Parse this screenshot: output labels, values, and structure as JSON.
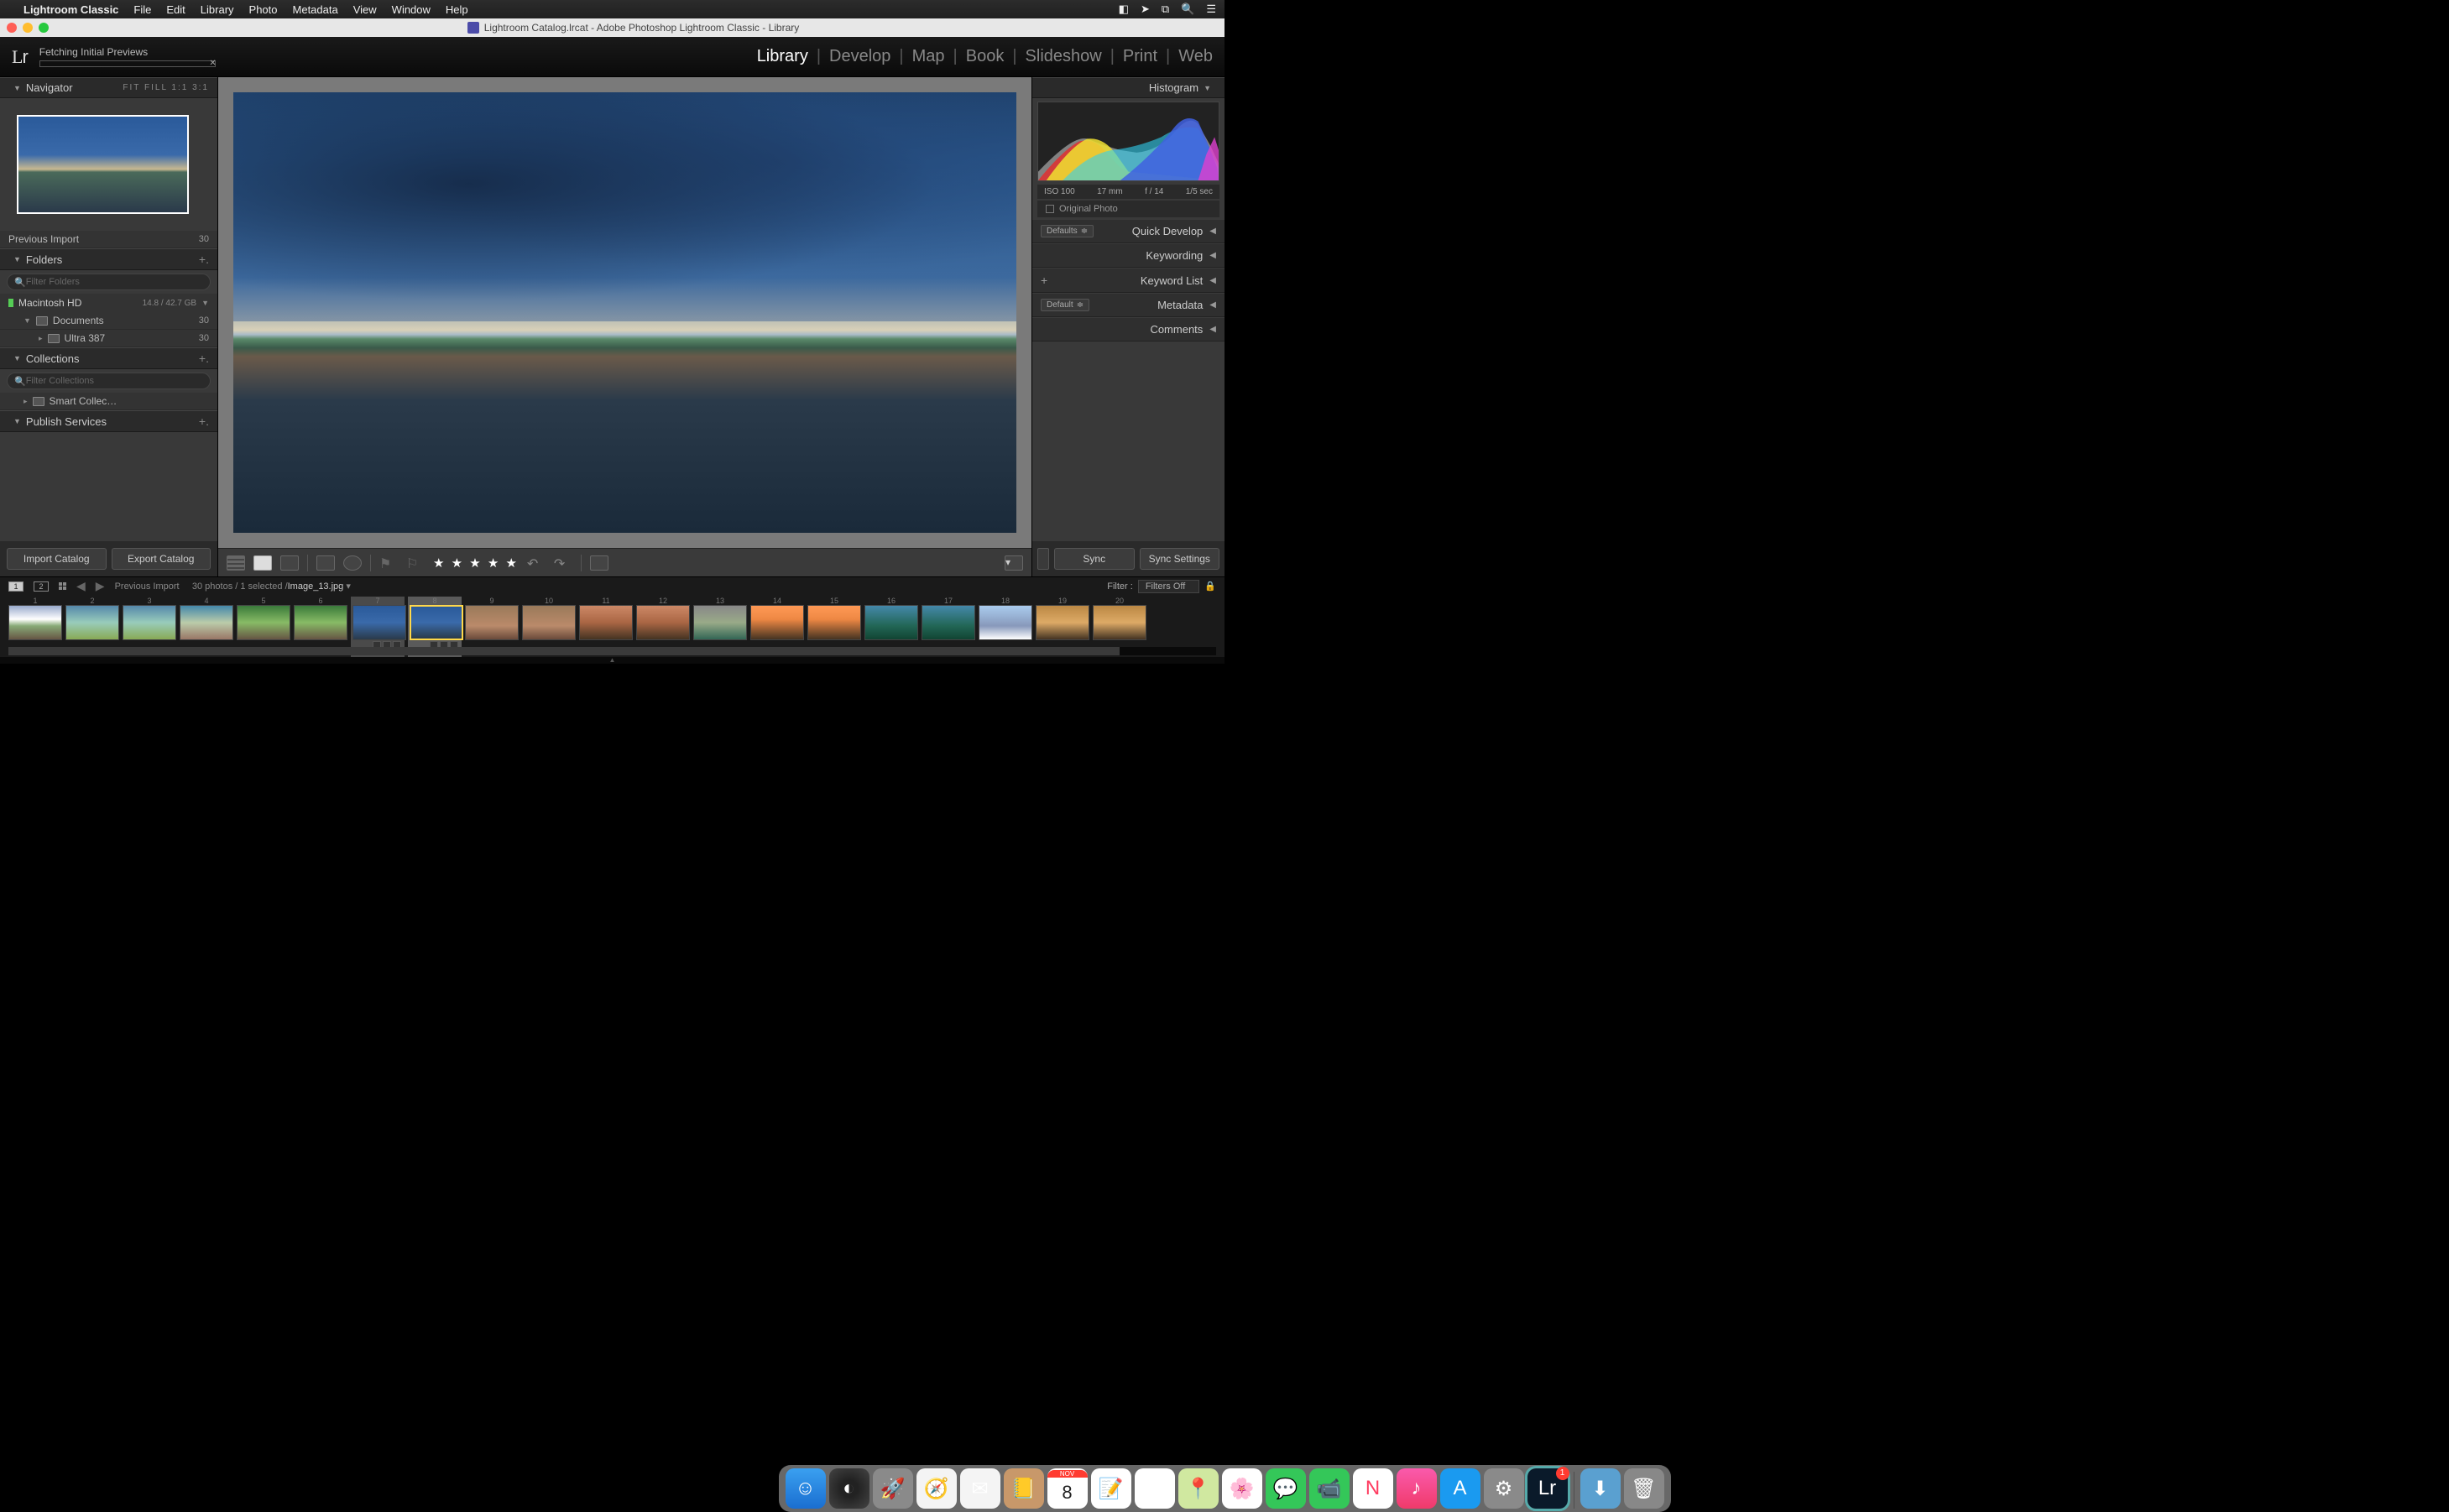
{
  "menubar": {
    "app": "Lightroom Classic",
    "items": [
      "File",
      "Edit",
      "Library",
      "Photo",
      "Metadata",
      "View",
      "Window",
      "Help"
    ]
  },
  "window": {
    "title": "Lightroom Catalog.lrcat - Adobe Photoshop Lightroom Classic - Library"
  },
  "topbar": {
    "logo": "Lr",
    "status": "Fetching Initial Previews",
    "modules": [
      "Library",
      "Develop",
      "Map",
      "Book",
      "Slideshow",
      "Print",
      "Web"
    ],
    "active_module": "Library"
  },
  "left": {
    "navigator": {
      "title": "Navigator",
      "zoom": "FIT   FILL   1:1   3:1"
    },
    "prev_import": {
      "label": "Previous Import",
      "count": "30"
    },
    "folders": {
      "title": "Folders",
      "filter_placeholder": "Filter Folders",
      "drive": {
        "name": "Macintosh HD",
        "size": "14.8 / 42.7 GB"
      },
      "items": [
        {
          "name": "Documents",
          "count": "30"
        },
        {
          "name": "Ultra 387",
          "count": "30"
        }
      ]
    },
    "collections": {
      "title": "Collections",
      "filter_placeholder": "Filter Collections",
      "smart": "Smart Collec…"
    },
    "publish": {
      "title": "Publish Services"
    },
    "buttons": {
      "import": "Import Catalog",
      "export": "Export Catalog"
    }
  },
  "right": {
    "histogram": {
      "title": "Histogram",
      "iso": "ISO 100",
      "focal": "17 mm",
      "aperture": "f / 14",
      "shutter": "1/5 sec"
    },
    "original": "Original Photo",
    "quick_develop": {
      "title": "Quick Develop",
      "preset": "Defaults"
    },
    "keywording": "Keywording",
    "keyword_list": "Keyword List",
    "metadata": {
      "title": "Metadata",
      "preset": "Default"
    },
    "comments": "Comments",
    "sync": "Sync",
    "sync_settings": "Sync Settings"
  },
  "toolbar": {
    "stars": "★ ★ ★ ★ ★"
  },
  "filmstrip": {
    "header": {
      "mon1": "1",
      "mon2": "2",
      "source": "Previous Import",
      "info": "30 photos / 1 selected /",
      "filename": "Image_13.jpg",
      "filter_label": "Filter :",
      "filter_value": "Filters Off"
    },
    "count": 20,
    "selected_index": 8,
    "hover_index": 7
  },
  "dock": {
    "items": [
      {
        "name": "finder",
        "bg": "linear-gradient(#3aa0f0,#1a6ed0)",
        "glyph": "☺"
      },
      {
        "name": "siri",
        "bg": "radial-gradient(circle,#222 30%,#444)",
        "glyph": "◐"
      },
      {
        "name": "launchpad",
        "bg": "#8a8a8a",
        "glyph": "🚀"
      },
      {
        "name": "safari",
        "bg": "#f4f4f4",
        "glyph": "🧭"
      },
      {
        "name": "mail",
        "bg": "#f4f4f4",
        "glyph": "✉"
      },
      {
        "name": "contacts",
        "bg": "#c8986a",
        "glyph": "📒"
      },
      {
        "name": "calendar",
        "bg": "#fff",
        "glyph": "8",
        "top": "NOV"
      },
      {
        "name": "notes",
        "bg": "#fff",
        "glyph": "📝"
      },
      {
        "name": "reminders",
        "bg": "#fff",
        "glyph": "☑"
      },
      {
        "name": "maps",
        "bg": "#d0e8a0",
        "glyph": "📍"
      },
      {
        "name": "photos",
        "bg": "#fff",
        "glyph": "🌸"
      },
      {
        "name": "messages",
        "bg": "#34c759",
        "glyph": "💬"
      },
      {
        "name": "facetime",
        "bg": "#34c759",
        "glyph": "📹"
      },
      {
        "name": "news",
        "bg": "#fff",
        "glyph": "N",
        "color": "#ff3b60"
      },
      {
        "name": "music",
        "bg": "linear-gradient(#fa5aac,#f03a6a)",
        "glyph": "♪"
      },
      {
        "name": "appstore",
        "bg": "#1a9af0",
        "glyph": "A"
      },
      {
        "name": "settings",
        "bg": "#8a8a8a",
        "glyph": "⚙"
      },
      {
        "name": "lightroom",
        "bg": "#0a1a2a",
        "glyph": "Lr",
        "badge": "1",
        "outline": "3px solid #5aa"
      },
      {
        "name": "downloads",
        "bg": "#5aa0d0",
        "glyph": "⬇",
        "sep_before": true
      },
      {
        "name": "trash",
        "bg": "#888",
        "glyph": "🗑"
      }
    ]
  }
}
